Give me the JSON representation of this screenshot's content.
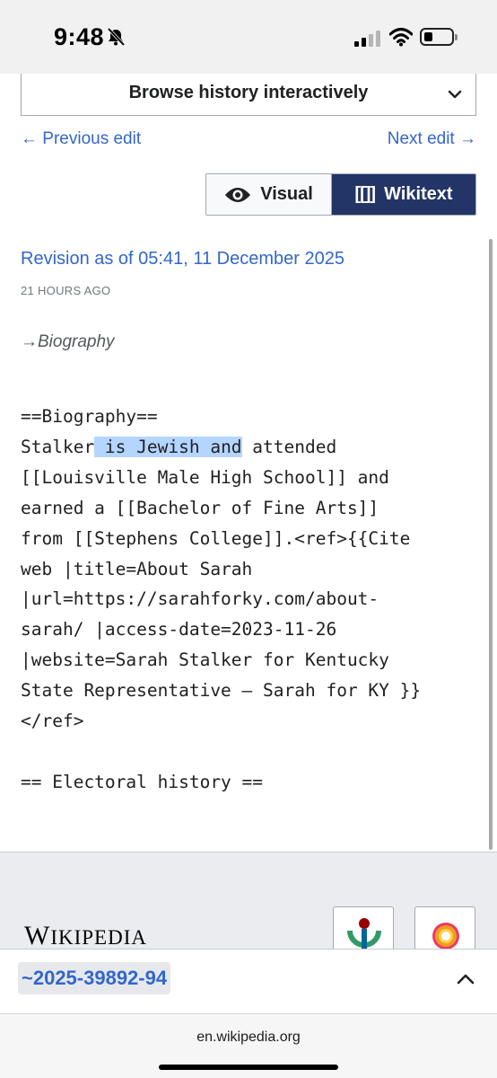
{
  "status": {
    "time": "9:48",
    "icons": [
      "bell-slash-icon",
      "signal-icon",
      "wifi-icon",
      "battery-icon"
    ]
  },
  "browse": {
    "label": "Browse history interactively",
    "icon": "chevron-down-icon"
  },
  "nav": {
    "previous": "← Previous edit",
    "next": "Next edit →"
  },
  "toggle": {
    "visual": "Visual",
    "wikitext": "Wikitext",
    "wikitext_icon": "[[]]",
    "selected": "wikitext"
  },
  "revision": {
    "title": "Revision as of 05:41, 11 December 2025",
    "ago": "21 HOURS AGO",
    "summary": "→Biography"
  },
  "wikitext": {
    "heading": "==Biography==",
    "line_before": "Stalker",
    "highlighted": " is Jewish and",
    "line_after": " attended",
    "rest": "[[Louisville Male High School]] and\nearned a [[Bachelor of Fine Arts]]\nfrom [[Stephens College]].<ref>{{Cite\nweb |title=About Sarah\n|url=https://sarahforky.com/about-\nsarah/ |access-date=2023-11-26\n|website=Sarah Stalker for Kentucky\nState Representative – Sarah for KY }}\n</ref>\n\n== Electoral history =="
  },
  "footer": {
    "logo_first": "W",
    "logo_rest": "IKIPEDIA",
    "badges": [
      "wikimedia-logo-icon",
      "mediawiki-logo-icon"
    ]
  },
  "user": {
    "name": "~2025-39892-94",
    "icon": "chevron-up-icon"
  },
  "browser": {
    "url": "en.wikipedia.org"
  },
  "colors": {
    "link": "#3366cc",
    "toggle_active": "#233566",
    "highlight": "#b4d5fe"
  }
}
